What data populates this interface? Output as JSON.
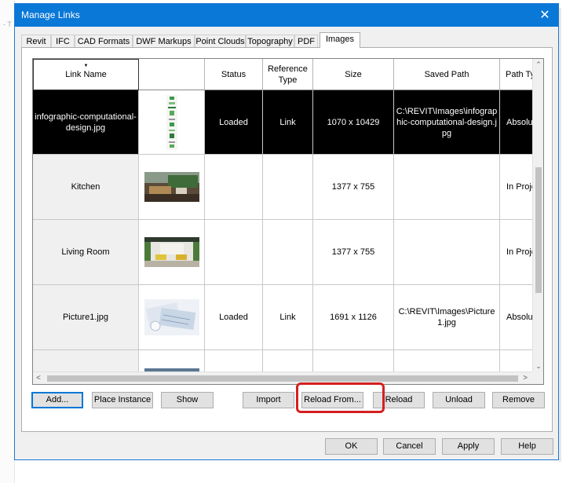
{
  "window": {
    "title": "Manage Links",
    "close_glyph": "✕"
  },
  "background": {
    "mark": "- T"
  },
  "tabs": [
    {
      "label": "Revit"
    },
    {
      "label": "IFC"
    },
    {
      "label": "CAD Formats"
    },
    {
      "label": "DWF Markups"
    },
    {
      "label": "Point Clouds"
    },
    {
      "label": "Topography"
    },
    {
      "label": "PDF"
    },
    {
      "label": "Images",
      "active": true
    }
  ],
  "columns": [
    "Link Name",
    "",
    "Status",
    "Reference Type",
    "Size",
    "Saved Path",
    "Path Ty"
  ],
  "rows": [
    {
      "name": "infographic-computational-design.jpg",
      "thumbnail": "tall-infographic",
      "status": "Loaded",
      "reference_type": "Link",
      "size": "1070 x 10429",
      "saved_path": "C:\\REVIT\\Images\\infographic-computational-design.jpg",
      "path_type": "Absolu",
      "selected": true
    },
    {
      "name": "Kitchen",
      "thumbnail": "kitchen-render",
      "status": "",
      "reference_type": "",
      "size": "1377 x 755",
      "saved_path": "",
      "path_type": "In Proje"
    },
    {
      "name": "Living Room",
      "thumbnail": "living-room-render",
      "status": "",
      "reference_type": "",
      "size": "1377 x 755",
      "saved_path": "",
      "path_type": "In Proje"
    },
    {
      "name": "Picture1.jpg",
      "thumbnail": "blueprints-photo",
      "status": "Loaded",
      "reference_type": "Link",
      "size": "1691 x 1126",
      "saved_path": "C:\\REVIT\\Images\\Picture1.jpg",
      "path_type": "Absolu"
    },
    {
      "name": "",
      "thumbnail": "partial-photo",
      "status": "",
      "reference_type": "",
      "size": "",
      "saved_path": "",
      "path_type": ""
    }
  ],
  "scroll": {
    "left": "<",
    "right": ">",
    "up": "⌃",
    "down": "⌄"
  },
  "actions": {
    "add": "Add...",
    "place_instance": "Place Instance",
    "show": "Show",
    "import": "Import",
    "reload_from": "Reload From...",
    "reload": "Reload",
    "unload": "Unload",
    "remove": "Remove"
  },
  "footer": {
    "ok": "OK",
    "cancel": "Cancel",
    "apply": "Apply",
    "help": "Help"
  },
  "colors": {
    "titlebar": "#0a78d7",
    "selection": "#000000",
    "highlight": "#d42020",
    "default_button": "#0078d7"
  }
}
